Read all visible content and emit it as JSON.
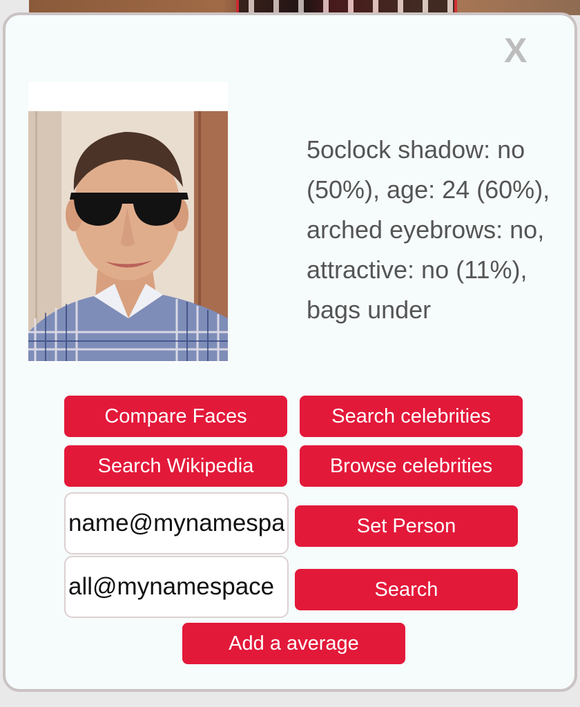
{
  "modal": {
    "close_label": "X",
    "attributes_text": "5oclock shadow: no (50%), age: 24 (60%), arched eyebrows: no, attractive: no (11%), bags under"
  },
  "buttons": {
    "compare_faces": "Compare Faces",
    "search_celebrities": "Search celebrities",
    "search_wikipedia": "Search Wikipedia",
    "browse_celebrities": "Browse celebrities",
    "set_person": "Set Person",
    "search": "Search",
    "add_average": "Add a average"
  },
  "inputs": {
    "person_value": "name@mynamespace",
    "search_value": "all@mynamespace"
  },
  "colors": {
    "accent": "#e3193a",
    "background": "#f6fbfb",
    "text": "#555555"
  }
}
